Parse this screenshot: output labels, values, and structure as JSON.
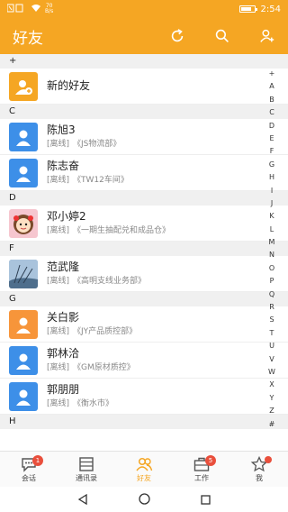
{
  "status_bar": {
    "signal": "⊠ ⊡",
    "speed_top": "70",
    "speed_bottom": "B/s",
    "time": "2:54",
    "battery_level": 0.8
  },
  "header": {
    "title": "好友",
    "icons": [
      "refresh-icon",
      "search-icon",
      "add-friend-icon"
    ]
  },
  "sections": {
    "plus": "+",
    "c": "C",
    "d": "D",
    "f": "F",
    "g": "G",
    "h": "H"
  },
  "contacts": {
    "new_friends": {
      "name": "新的好友"
    },
    "chenxu": {
      "name": "陈旭3",
      "status": "[离线]",
      "dept": "《JS物流部》"
    },
    "chenzhi": {
      "name": "陈志奋",
      "status": "[离线]",
      "dept": "《TW12车间》"
    },
    "deng": {
      "name": "邓小婷2",
      "status": "[离线]",
      "dept": "《一期生抽配兑和成品仓》"
    },
    "fan": {
      "name": "范武隆",
      "status": "[离线]",
      "dept": "《高明支线业务部》"
    },
    "guan": {
      "name": "关白影",
      "status": "[离线]",
      "dept": "《JY产品质控部》"
    },
    "guolin": {
      "name": "郭林洽",
      "status": "[离线]",
      "dept": "《GM原材质控》"
    },
    "guopeng": {
      "name": "郭朋朋",
      "status": "[离线]",
      "dept": "《衡水市》"
    }
  },
  "index_letters": [
    "+",
    "A",
    "B",
    "C",
    "D",
    "E",
    "F",
    "G",
    "H",
    "I",
    "J",
    "K",
    "L",
    "M",
    "N",
    "O",
    "P",
    "Q",
    "R",
    "S",
    "T",
    "U",
    "V",
    "W",
    "X",
    "Y",
    "Z",
    "#"
  ],
  "tabs": {
    "chat": {
      "label": "会话",
      "badge": "1"
    },
    "contacts": {
      "label": "通讯录"
    },
    "friends": {
      "label": "好友"
    },
    "work": {
      "label": "工作",
      "badge": "5"
    },
    "me": {
      "label": "我"
    }
  },
  "colors": {
    "accent": "#f5a623",
    "avatar_blue": "#3d8fe8",
    "avatar_orange": "#f7953a",
    "badge_red": "#e94f3c"
  }
}
